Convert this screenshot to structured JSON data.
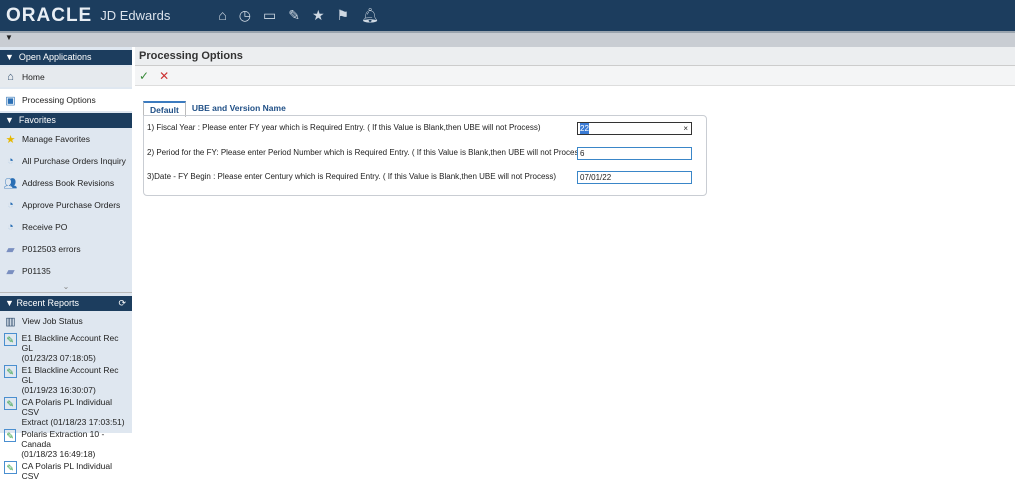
{
  "header": {
    "logo": "ORACLE",
    "product": "JD Edwards",
    "icons": [
      "home-icon",
      "clock-icon",
      "monitor-chart-icon",
      "edit-icon",
      "star-icon",
      "flag-icon",
      "bell-icon"
    ]
  },
  "sidebar": {
    "open_apps": {
      "title": "Open Applications",
      "items": [
        {
          "label": "Home"
        },
        {
          "label": "Processing Options"
        }
      ]
    },
    "favorites": {
      "title": "Favorites",
      "items": [
        {
          "label": "Manage Favorites"
        },
        {
          "label": "All Purchase Orders Inquiry"
        },
        {
          "label": "Address Book Revisions"
        },
        {
          "label": "Approve Purchase Orders"
        },
        {
          "label": "Receive PO"
        },
        {
          "label": "P012503 errors"
        },
        {
          "label": "P01135"
        }
      ]
    },
    "recent": {
      "title": "Recent Reports",
      "job_status": "View Job Status",
      "items": [
        {
          "name": "E1 Blackline Account Rec GL",
          "time": "(01/23/23 07:18:05)"
        },
        {
          "name": "E1 Blackline Account Rec GL",
          "time": "(01/19/23 16:30:07)"
        },
        {
          "name": "CA Polaris PL Individual CSV",
          "time": "Extract (01/18/23 17:03:51)"
        },
        {
          "name": "Polaris Extraction 10 - Canada",
          "time": "(01/18/23 16:49:18)"
        },
        {
          "name": "CA Polaris PL Individual CSV",
          "time": ""
        }
      ]
    }
  },
  "main": {
    "title": "Processing Options",
    "ok": "✓",
    "cancel": "✕",
    "tabs": [
      "Default",
      "UBE and Version Name"
    ],
    "options": [
      {
        "label": "1) Fiscal Year  :  Please enter FY year which is Required Entry. ( If this Value is Blank,then UBE will not Process)",
        "value": "22"
      },
      {
        "label": "2) Period for the FY: Please enter Period  Number  which is Required Entry. ( If this Value is Blank,then UBE will not Process)",
        "value": "6"
      },
      {
        "label": "3)Date - FY Begin : Please enter Century which is Required Entry. ( If this Value is Blank,then UBE will not Process)",
        "value": "07/01/22"
      }
    ],
    "clear": "×"
  }
}
